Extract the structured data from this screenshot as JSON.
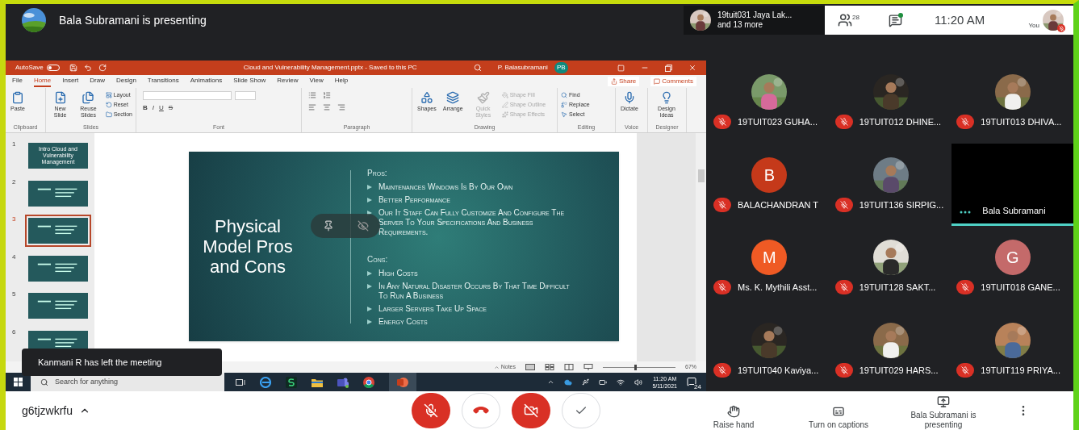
{
  "header": {
    "presenter_banner": "Bala Subramani is presenting",
    "people_chip": {
      "name": "19tuit031 Jaya Lak...",
      "more": "and 13 more"
    },
    "participant_count": "28",
    "chat_unread": true,
    "time": "11:20 AM",
    "self_label": "You",
    "self_muted": true
  },
  "powerpoint": {
    "autosave": "AutoSave",
    "file_title": "Cloud and Vulnerability Management.pptx - Saved to this PC",
    "user": "P. Balasubramani",
    "user_initials": "PB",
    "ribbon_tabs": [
      {
        "label": "File",
        "selected": false
      },
      {
        "label": "Home",
        "selected": true
      },
      {
        "label": "Insert",
        "selected": false
      },
      {
        "label": "Draw",
        "selected": false
      },
      {
        "label": "Design",
        "selected": false
      },
      {
        "label": "Transitions",
        "selected": false
      },
      {
        "label": "Animations",
        "selected": false
      },
      {
        "label": "Slide Show",
        "selected": false
      },
      {
        "label": "Review",
        "selected": false
      },
      {
        "label": "View",
        "selected": false
      },
      {
        "label": "Help",
        "selected": false
      }
    ],
    "share": "Share",
    "comments": "Comments",
    "ribbon_groups": [
      {
        "label": "Clipboard",
        "kind": "commands",
        "commands": [
          {
            "label": "Paste",
            "kind": "large",
            "disabled": false
          }
        ]
      },
      {
        "label": "Slides",
        "kind": "commands",
        "commands": [
          {
            "label": "New Slide",
            "kind": "large",
            "disabled": false
          },
          {
            "label": "Reuse Slides",
            "kind": "large",
            "disabled": false
          },
          {
            "label": "Layout",
            "kind": "small",
            "disabled": false
          },
          {
            "label": "Reset",
            "kind": "small",
            "disabled": false
          },
          {
            "label": "Section",
            "kind": "small",
            "disabled": false
          }
        ]
      },
      {
        "label": "Font",
        "kind": "font",
        "format_buttons": [
          "B",
          "I",
          "U",
          "S"
        ]
      },
      {
        "label": "Paragraph",
        "kind": "paragraph"
      },
      {
        "label": "Drawing",
        "kind": "commands",
        "commands": [
          {
            "label": "Shapes",
            "kind": "large",
            "disabled": false
          },
          {
            "label": "Arrange",
            "kind": "large",
            "disabled": false
          },
          {
            "label": "Quick Styles",
            "kind": "large",
            "disabled": true
          },
          {
            "label": "Shape Fill",
            "kind": "small",
            "disabled": true
          },
          {
            "label": "Shape Outline",
            "kind": "small",
            "disabled": true
          },
          {
            "label": "Shape Effects",
            "kind": "small",
            "disabled": true
          }
        ]
      },
      {
        "label": "Editing",
        "kind": "commands",
        "commands": [
          {
            "label": "Find",
            "kind": "small",
            "disabled": false
          },
          {
            "label": "Replace",
            "kind": "small",
            "disabled": false
          },
          {
            "label": "Select",
            "kind": "small",
            "disabled": false
          }
        ]
      },
      {
        "label": "Voice",
        "kind": "commands",
        "commands": [
          {
            "label": "Dictate",
            "kind": "large",
            "disabled": false
          }
        ]
      },
      {
        "label": "Designer",
        "kind": "commands",
        "commands": [
          {
            "label": "Design Ideas",
            "kind": "large",
            "disabled": false
          }
        ]
      }
    ],
    "thumbnails": [
      {
        "number": "1",
        "selected": false,
        "title": "Intro Cloud and Vulnerability Management"
      },
      {
        "number": "2",
        "selected": false
      },
      {
        "number": "3",
        "selected": true
      },
      {
        "number": "4",
        "selected": false
      },
      {
        "number": "5",
        "selected": false
      },
      {
        "number": "6",
        "selected": false
      }
    ],
    "slide": {
      "title": "Physical Model Pros and Cons",
      "sections": [
        {
          "heading": "Pros:",
          "items": [
            "Maintenances Windows Is By Our Own",
            "Better Performance",
            "Our It Staff Can Fully Customize And Configure The Server To Your Specifications And Business Requirements."
          ]
        },
        {
          "heading": "Cons:",
          "items": [
            "High Costs",
            "In Any Natural Disaster Occurs By That Time Difficult To Run A Business",
            "Larger Servers Take Up Space",
            "Energy Costs"
          ]
        }
      ]
    },
    "status_bar": {
      "notes": "Notes",
      "zoom": "67%",
      "zoom_slider": {
        "level": 0.45
      }
    }
  },
  "taskbar": {
    "search_placeholder": "Search for anything",
    "time": "11:20 AM",
    "date": "5/11/2021",
    "notifications": "24"
  },
  "toast": "Kanmani R has left the meeting",
  "participants": [
    {
      "name": "19TUIT023 GUHA...",
      "muted": true
    },
    {
      "name": "19TUIT012 DHINE...",
      "muted": true
    },
    {
      "name": "19TUIT013 DHIVA...",
      "muted": true
    },
    {
      "name": "BALACHANDRAN T",
      "kind": "letter",
      "initial": "B",
      "color": "#c5391a",
      "muted": true
    },
    {
      "name": "19TUIT136 SIRPIG...",
      "muted": true
    },
    {
      "name": "Bala Subramani",
      "kind": "video",
      "speaking": true
    },
    {
      "name": "Ms. K. Mythili Asst...",
      "kind": "letter",
      "initial": "M",
      "color": "#ef5a24",
      "muted": true
    },
    {
      "name": "19TUIT128 SAKT...",
      "muted": true
    },
    {
      "name": "19TUIT018 GANE...",
      "kind": "letter",
      "initial": "G",
      "color": "#c46a6a",
      "muted": true
    },
    {
      "name": "19TUIT040 Kaviya...",
      "muted": true
    },
    {
      "name": "19TUIT029 HARS...",
      "muted": true
    },
    {
      "name": "19TUIT119 PRIYA...",
      "muted": true
    }
  ],
  "bottom_bar": {
    "meeting_code": "g6tjzwkrfu",
    "controls": [
      {
        "kind": "mic",
        "off": true
      },
      {
        "kind": "hangup"
      },
      {
        "kind": "camera",
        "off": true
      },
      {
        "kind": "check"
      }
    ],
    "actions": [
      {
        "label": "Raise hand",
        "kind": "hand"
      },
      {
        "label": "Turn on captions",
        "kind": "captions"
      },
      {
        "label": "Bala Subramani is presenting",
        "kind": "present"
      }
    ]
  }
}
